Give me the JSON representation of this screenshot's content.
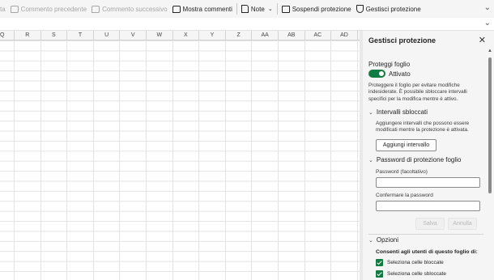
{
  "toolbar": {
    "partial_label": "ta",
    "prev_comment": "Commento precedente",
    "next_comment": "Commento successivo",
    "show_comments": "Mostra commenti",
    "notes": "Note",
    "suspend_protection": "Sospendi protezione",
    "manage_protection": "Gestisci protezione"
  },
  "columns": [
    "Q",
    "R",
    "S",
    "T",
    "U",
    "V",
    "W",
    "X",
    "Y",
    "Z",
    "AA",
    "AB",
    "AC",
    "AD"
  ],
  "panel": {
    "title": "Gestisci protezione",
    "protect_sheet": {
      "title": "Proteggi foglio",
      "toggle_label": "Attivato",
      "toggle_on": true,
      "description": "Proteggere il foglio per evitare modifiche indesiderate. È possibile sbloccare intervalli specifici per la modifica mentre è attivo."
    },
    "unlocked_ranges": {
      "title": "Intervalli sbloccati",
      "description": "Aggiungere intervalli che possono essere modificati mentre la protezione è attivata.",
      "add_button": "Aggiungi intervallo"
    },
    "password": {
      "title": "Password di protezione foglio",
      "password_label": "Password (facoltativo)",
      "password_value": "",
      "confirm_label": "Confermare la password",
      "confirm_value": "",
      "save_button": "Salva",
      "cancel_button": "Annulla"
    },
    "options": {
      "title": "Opzioni",
      "allow_label": "Consenti agli utenti di questo foglio di:",
      "items": [
        {
          "label": "Seleziona celle bloccate",
          "checked": true
        },
        {
          "label": "Seleziona celle sbloccate",
          "checked": true
        }
      ]
    }
  },
  "colors": {
    "accent": "#107c41"
  }
}
